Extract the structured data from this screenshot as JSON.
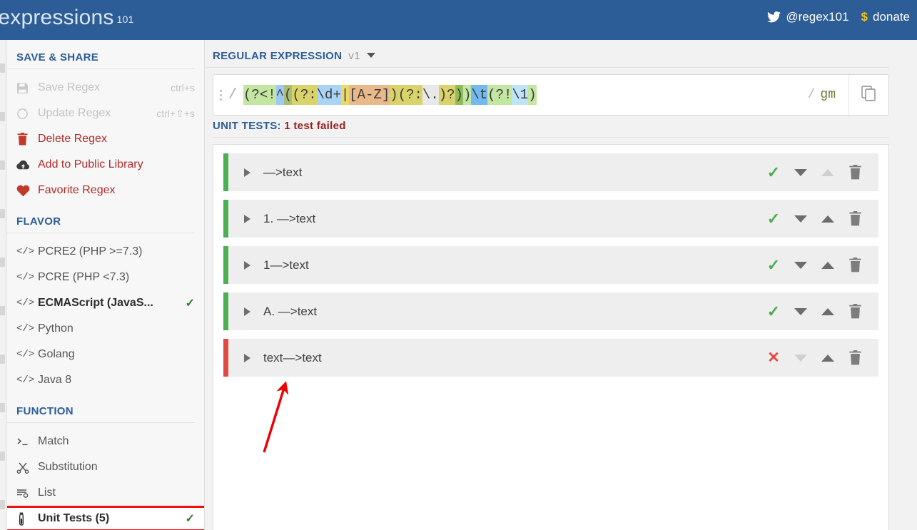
{
  "topbar": {
    "brand_text": "ular expressions",
    "brand_sup": "101",
    "twitter_icon": "twitter-bird-icon",
    "twitter_handle": "@regex101",
    "donate_symbol": "$",
    "donate_label": "donate",
    "bg_color": "#2c5d96"
  },
  "sidebar": {
    "save_share": {
      "heading": "SAVE & SHARE",
      "items": [
        {
          "icon": "floppy-disk-icon",
          "label": "Save Regex",
          "shortcut": "ctrl+s",
          "state": "disabled"
        },
        {
          "icon": "refresh-circle-icon",
          "label": "Update Regex",
          "shortcut": "ctrl+⇧+s",
          "state": "disabled"
        },
        {
          "icon": "trash-icon",
          "label": "Delete Regex",
          "shortcut": "",
          "state": "enabled"
        },
        {
          "icon": "cloud-upload-icon",
          "label": "Add to Public Library",
          "shortcut": "",
          "state": "enabled"
        },
        {
          "icon": "heart-icon",
          "label": "Favorite Regex",
          "shortcut": "",
          "state": "enabled"
        }
      ]
    },
    "flavor": {
      "heading": "FLAVOR",
      "items": [
        {
          "icon": "code-tags-icon",
          "label": "PCRE2 (PHP >=7.3)",
          "selected": false
        },
        {
          "icon": "code-tags-icon",
          "label": "PCRE (PHP <7.3)",
          "selected": false
        },
        {
          "icon": "code-tags-icon",
          "label": "ECMAScript (JavaS...",
          "selected": true
        },
        {
          "icon": "code-tags-icon",
          "label": "Python",
          "selected": false
        },
        {
          "icon": "code-tags-icon",
          "label": "Golang",
          "selected": false
        },
        {
          "icon": "code-tags-icon",
          "label": "Java 8",
          "selected": false
        }
      ],
      "check_glyph": "✓"
    },
    "function": {
      "heading": "FUNCTION",
      "items": [
        {
          "icon": "terminal-prompt-icon",
          "label": "Match",
          "selected": false,
          "highlighted": false
        },
        {
          "icon": "scissors-icon",
          "label": "Substitution",
          "selected": false,
          "highlighted": false
        },
        {
          "icon": "list-settings-icon",
          "label": "List",
          "selected": false,
          "highlighted": false
        },
        {
          "icon": "test-tube-icon",
          "label": "Unit Tests (5)",
          "selected": true,
          "highlighted": true
        }
      ],
      "check_glyph": "✓",
      "highlight_color": "#ee1111"
    }
  },
  "main": {
    "regex_section": {
      "heading": "REGULAR EXPRESSION",
      "version": "v1",
      "caret_icon": "chevron-down-icon",
      "grip_icon": "drag-handle-icon",
      "open_delimiter": "/",
      "close_delimiter": "/",
      "flags": "gm",
      "copy_icon": "copy-icon",
      "pattern": "(?<!^((?:\\d+|[A-Z])(?:\\.)?))\\t(?!\\1)",
      "tokens": [
        {
          "t": "(?<!",
          "bg": "#c3e6a0"
        },
        {
          "t": "^",
          "bg": "#9ec9f5"
        },
        {
          "t": "(",
          "bg": "#aabf74"
        },
        {
          "t": "(?:",
          "bg": "#d9d36a"
        },
        {
          "t": "\\d+",
          "bg": "#a9d4f5"
        },
        {
          "t": "|",
          "bg": "#ead86b"
        },
        {
          "t": "[A-Z]",
          "bg": "#e9b98a"
        },
        {
          "t": ")",
          "bg": "#d9d36a"
        },
        {
          "t": "(?:",
          "bg": "#d9d36a"
        },
        {
          "t": "\\.",
          "bg": "#e8e8e8"
        },
        {
          "t": ")?",
          "bg": "#d9d36a"
        },
        {
          "t": ")",
          "bg": "#8fbc5a"
        },
        {
          "t": ")",
          "bg": "#c3e6a0"
        },
        {
          "t": "\\t",
          "bg": "#74b9f2"
        },
        {
          "t": "(?!",
          "bg": "#c3e6a0"
        },
        {
          "t": "\\1",
          "bg": "#bfe3f7"
        },
        {
          "t": ")",
          "bg": "#c3e6a0"
        }
      ]
    },
    "unit_tests": {
      "heading": "UNIT TESTS:",
      "status": "1 test failed",
      "status_color": "#9c2020",
      "rows": [
        {
          "title": "—>text",
          "result": "pass",
          "result_icon": "check-icon",
          "expand_icon": "triangle-right-icon",
          "move_down_icon": "triangle-down-icon",
          "move_up_icon": "triangle-up-icon",
          "delete_icon": "trash-icon",
          "move_down_enabled": true,
          "move_up_enabled": false
        },
        {
          "title": "1. —>text",
          "result": "pass",
          "result_icon": "check-icon",
          "expand_icon": "triangle-right-icon",
          "move_down_icon": "triangle-down-icon",
          "move_up_icon": "triangle-up-icon",
          "delete_icon": "trash-icon",
          "move_down_enabled": true,
          "move_up_enabled": true
        },
        {
          "title": "1—>text",
          "result": "pass",
          "result_icon": "check-icon",
          "expand_icon": "triangle-right-icon",
          "move_down_icon": "triangle-down-icon",
          "move_up_icon": "triangle-up-icon",
          "delete_icon": "trash-icon",
          "move_down_enabled": true,
          "move_up_enabled": true
        },
        {
          "title": "A. —>text",
          "result": "pass",
          "result_icon": "check-icon",
          "expand_icon": "triangle-right-icon",
          "move_down_icon": "triangle-down-icon",
          "move_up_icon": "triangle-up-icon",
          "delete_icon": "trash-icon",
          "move_down_enabled": true,
          "move_up_enabled": true
        },
        {
          "title": "text—>text",
          "result": "fail",
          "result_icon": "cross-icon",
          "expand_icon": "triangle-right-icon",
          "move_down_icon": "triangle-down-icon",
          "move_up_icon": "triangle-up-icon",
          "delete_icon": "trash-icon",
          "move_down_enabled": false,
          "move_up_enabled": true
        }
      ],
      "pass_glyph": "✓",
      "fail_glyph": "✕",
      "pass_color": "#4caf50",
      "fail_color": "#e04a41"
    },
    "annotation": {
      "icon": "red-arrow-annotation",
      "color": "#ee0000"
    }
  }
}
